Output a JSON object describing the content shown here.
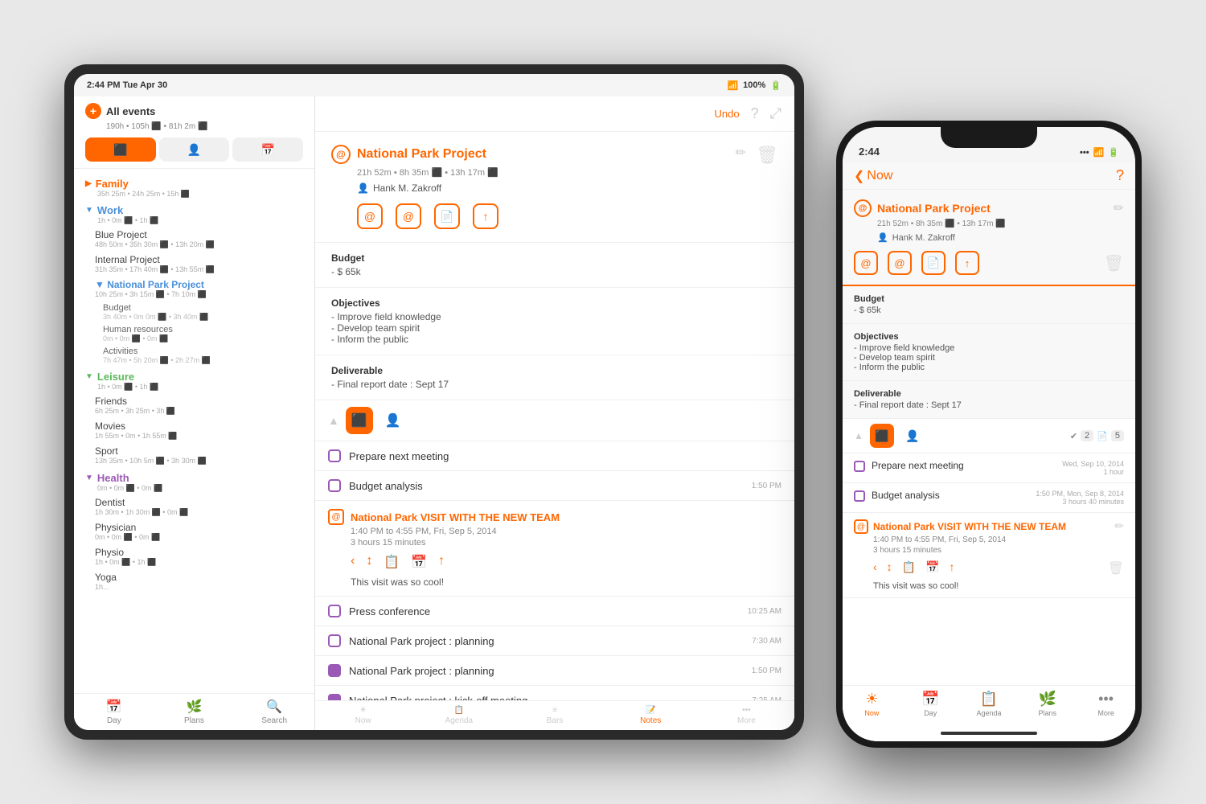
{
  "tablet": {
    "statusBar": {
      "time": "2:44 PM  Tue Apr 30",
      "wifi": "WiFi",
      "battery": "100%"
    },
    "toolbar": {
      "undo": "Undo",
      "help": "?",
      "expand": "⤢"
    },
    "sidebar": {
      "allEvents": "All events",
      "stats": "190h • 105h ⬛ • 81h 2m ⬛",
      "tabs": [
        {
          "label": "⬛",
          "active": true
        },
        {
          "label": "👤",
          "active": false
        },
        {
          "label": "📅",
          "active": false
        }
      ],
      "categories": [
        {
          "name": "Family",
          "color": "orange",
          "collapsed": true,
          "stats": "35h 25m • 24h 25m • 15h ⬛"
        },
        {
          "name": "Work",
          "color": "blue",
          "collapsed": false,
          "stats": "1h • 0m ⬛ • 1h ⬛",
          "projects": [
            {
              "name": "Blue Project",
              "stats": "48h 50m • 35h 30m ⬛ • 13h 20m ⬛",
              "active": false
            },
            {
              "name": "Internal Project",
              "stats": "31h 35m • 17h 40m ⬛ • 13h 55m ⬛",
              "active": false
            },
            {
              "name": "National Park Project",
              "stats": "10h 25m • 3h 15m ⬛ • 7h 10m ⬛",
              "active": true,
              "subprojects": [
                {
                  "name": "Budget",
                  "stats": "3h 40m • 0m 0m ⬛ • 3h 40m ⬛"
                },
                {
                  "name": "Human resources",
                  "stats": "0m • 0m ⬛ • 0m ⬛"
                },
                {
                  "name": "Activities",
                  "stats": "7h 47m • 5h 20m ⬛ • 2h 27m ⬛"
                }
              ]
            }
          ]
        },
        {
          "name": "Leisure",
          "color": "green",
          "collapsed": false,
          "stats": "1h • 0m ⬛ • 1h ⬛",
          "projects": [
            {
              "name": "Friends",
              "stats": "6h 25m • 3h 25m • 3h ⬛"
            },
            {
              "name": "Movies",
              "stats": "1h 55m • 0m • 1h 55m ⬛"
            },
            {
              "name": "Sport",
              "stats": "13h 35m • 10h 5m ⬛ • 3h 30m ⬛"
            }
          ]
        },
        {
          "name": "Health",
          "color": "purple",
          "collapsed": false,
          "stats": "0m • 0m ⬛ • 0m ⬛",
          "projects": [
            {
              "name": "Dentist",
              "stats": "1h 30m • 1h 30m ⬛ • 0m ⬛"
            },
            {
              "name": "Physician",
              "stats": "0m • 0m ⬛ • 0m ⬛"
            },
            {
              "name": "Physio",
              "stats": "1h • 0m ⬛ • 1h ⬛"
            },
            {
              "name": "Yoga",
              "stats": "1h..."
            }
          ]
        }
      ],
      "footer": [
        {
          "label": "Day",
          "icon": "📅",
          "active": false
        },
        {
          "label": "Plans",
          "icon": "🌿",
          "active": false
        },
        {
          "label": "Search",
          "icon": "🔍",
          "active": false
        }
      ]
    },
    "detail": {
      "projectName": "National Park Project",
      "timeStats": "21h 52m • 8h 35m ⬛ • 13h 17m ⬛",
      "person": "Hank M. Zakroff",
      "budget": {
        "label": "Budget",
        "value": "- $ 65k"
      },
      "objectives": {
        "label": "Objectives",
        "value": "- Improve field knowledge\n- Develop team spirit\n- Inform the public"
      },
      "deliverable": {
        "label": "Deliverable",
        "value": "- Final report date : Sept 17"
      }
    },
    "agendaItems": [
      {
        "type": "task",
        "text": "Prepare next meeting",
        "time": ""
      },
      {
        "type": "task",
        "text": "Budget analysis",
        "time": "1:50 PM"
      },
      {
        "type": "visit",
        "title": "National Park VISIT WITH THE NEW TEAM",
        "when": "1:40 PM to 4:55 PM, Fri, Sep 5, 2014",
        "duration": "3 hours 15 minutes",
        "note": "This visit was so cool!"
      },
      {
        "type": "task",
        "text": "Press conference",
        "time": "10:25 AM"
      },
      {
        "type": "task",
        "text": "National Park project : planning",
        "time": "7:30 AM"
      },
      {
        "type": "task",
        "text": "National Park project : planning",
        "time": "1:50 PM",
        "checked": true
      },
      {
        "type": "task",
        "text": "National Park project : kick-off meeting",
        "time": "7:25 AM",
        "checked": true
      }
    ]
  },
  "phone": {
    "statusBar": {
      "time": "2:44",
      "icons": "... WiFi 📶"
    },
    "nav": {
      "back": "Now",
      "help": "?"
    },
    "detail": {
      "projectName": "National Park Project",
      "timeStats": "21h 52m • 8h 35m ⬛ • 13h 17m ⬛",
      "person": "Hank M. Zakroff",
      "budget": {
        "label": "Budget",
        "value": "- $ 65k"
      },
      "objectives": {
        "label": "Objectives",
        "value": "- Improve field knowledge\n- Develop team spirit\n- Inform the public"
      },
      "deliverable": {
        "label": "Deliverable",
        "value": "- Final report date : Sept 17"
      }
    },
    "badges": {
      "tasks": "2",
      "notes": "5"
    },
    "agendaItems": [
      {
        "type": "task",
        "text": "Prepare next meeting",
        "date": "Wed, Sep 10, 2014",
        "duration": "1 hour"
      },
      {
        "type": "task",
        "text": "Budget analysis",
        "date": "1:50 PM, Mon, Sep 8, 2014",
        "duration": "3 hours 40 minutes"
      },
      {
        "type": "visit",
        "title": "National Park VISIT WITH THE NEW TEAM",
        "when": "1:40 PM to 4:55 PM, Fri, Sep 5, 2014",
        "duration": "3 hours 15 minutes",
        "note": "This visit was so cool!"
      }
    ],
    "bottomNav": [
      {
        "label": "Now",
        "icon": "☀",
        "active": true
      },
      {
        "label": "Day",
        "icon": "📅",
        "active": false
      },
      {
        "label": "Agenda",
        "icon": "📋",
        "active": false
      },
      {
        "label": "Plans",
        "icon": "🌿",
        "active": false
      },
      {
        "label": "More",
        "icon": "•••",
        "active": false
      }
    ]
  }
}
